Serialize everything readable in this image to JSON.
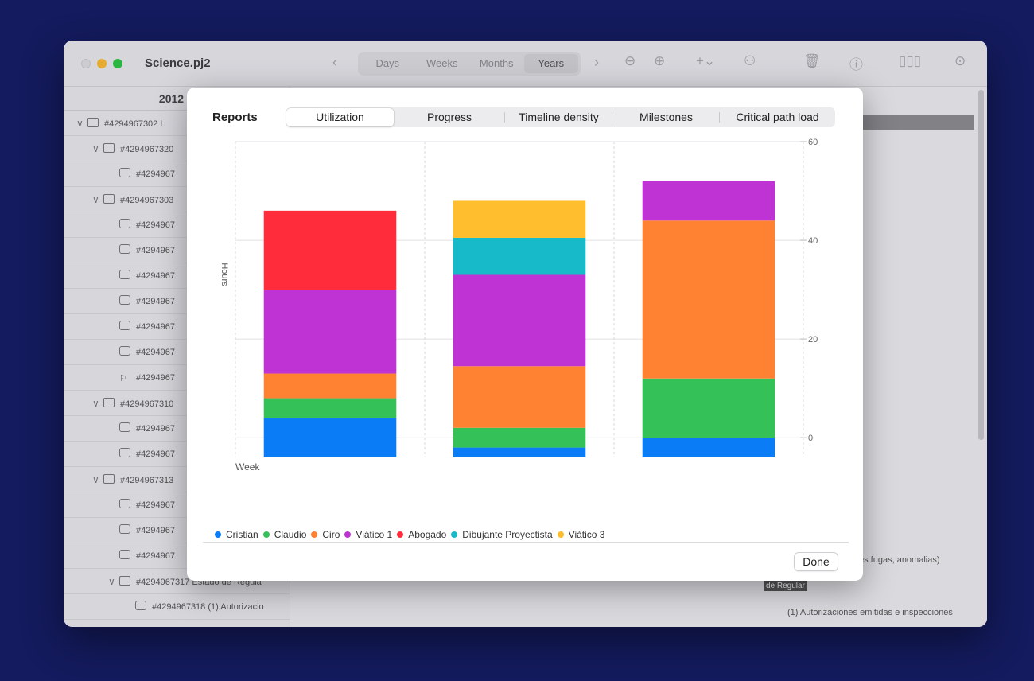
{
  "window": {
    "title": "Science.pj2",
    "scale_tabs": [
      {
        "label": "Days",
        "selected": false
      },
      {
        "label": "Weeks",
        "selected": false
      },
      {
        "label": "Months",
        "selected": false
      },
      {
        "label": "Years",
        "selected": true
      }
    ],
    "year_header": "2012",
    "rows": [
      {
        "text": "#4294967302  L",
        "kind": "folder",
        "indent": 0
      },
      {
        "text": "#4294967320",
        "kind": "folder",
        "indent": 1
      },
      {
        "text": "#4294967",
        "kind": "task",
        "indent": 2
      },
      {
        "text": "#4294967303",
        "kind": "folder",
        "indent": 1
      },
      {
        "text": "#4294967",
        "kind": "task",
        "indent": 2
      },
      {
        "text": "#4294967",
        "kind": "task",
        "indent": 2
      },
      {
        "text": "#4294967",
        "kind": "task",
        "indent": 2
      },
      {
        "text": "#4294967",
        "kind": "task",
        "indent": 2
      },
      {
        "text": "#4294967",
        "kind": "task",
        "indent": 2
      },
      {
        "text": "#4294967",
        "kind": "task",
        "indent": 2
      },
      {
        "text": "#4294967",
        "kind": "flag",
        "indent": 2
      },
      {
        "text": "#4294967310",
        "kind": "folder",
        "indent": 1
      },
      {
        "text": "#4294967",
        "kind": "task",
        "indent": 2
      },
      {
        "text": "#4294967",
        "kind": "task",
        "indent": 2
      },
      {
        "text": "#4294967313",
        "kind": "folder",
        "indent": 1
      },
      {
        "text": "#4294967",
        "kind": "task",
        "indent": 2
      },
      {
        "text": "#4294967",
        "kind": "task",
        "indent": 2
      },
      {
        "text": "#4294967",
        "kind": "task",
        "indent": 2
      },
      {
        "text": "#4294967317  Estado de Regula",
        "kind": "folder",
        "indent": 2
      },
      {
        "text": "#4294967318  (1) Autorizacio",
        "kind": "task",
        "indent": 3
      }
    ],
    "timeline_texts": {
      "fugas": "es fugas, anomalias)",
      "regular": "de Regular",
      "autorizaciones": "(1) Autorizaciones emitidas e inspecciones"
    }
  },
  "modal": {
    "title": "Reports",
    "tabs": [
      {
        "label": "Utilization",
        "selected": true
      },
      {
        "label": "Progress",
        "selected": false
      },
      {
        "label": "Timeline density",
        "selected": false
      },
      {
        "label": "Milestones",
        "selected": false
      },
      {
        "label": "Critical path load",
        "selected": false
      }
    ],
    "done_label": "Done"
  },
  "chart_data": {
    "type": "bar",
    "stacked": true,
    "ylabel": "Hours",
    "xlabel": "Week",
    "ylim": [
      -4,
      60
    ],
    "yticks": [
      0,
      20,
      40,
      60
    ],
    "grid": true,
    "legend_position": "bottom",
    "categories": [
      "",
      "",
      ""
    ],
    "series": [
      {
        "name": "Cristian",
        "color": "#0a7cf5",
        "values": [
          8,
          2,
          4
        ]
      },
      {
        "name": "Claudio",
        "color": "#33c158",
        "values": [
          4,
          4,
          12
        ]
      },
      {
        "name": "Ciro",
        "color": "#ff8232",
        "values": [
          5,
          12.5,
          32
        ]
      },
      {
        "name": "Viático 1",
        "color": "#bf33d4",
        "values": [
          17,
          18.5,
          8
        ]
      },
      {
        "name": "Abogado",
        "color": "#ff2d3c",
        "values": [
          16,
          0,
          0
        ]
      },
      {
        "name": "Dibujante Proyectista",
        "color": "#17bac8",
        "values": [
          0,
          7.5,
          0
        ]
      },
      {
        "name": "Viático 3",
        "color": "#ffbe2e",
        "values": [
          0,
          7.5,
          0
        ]
      }
    ]
  }
}
